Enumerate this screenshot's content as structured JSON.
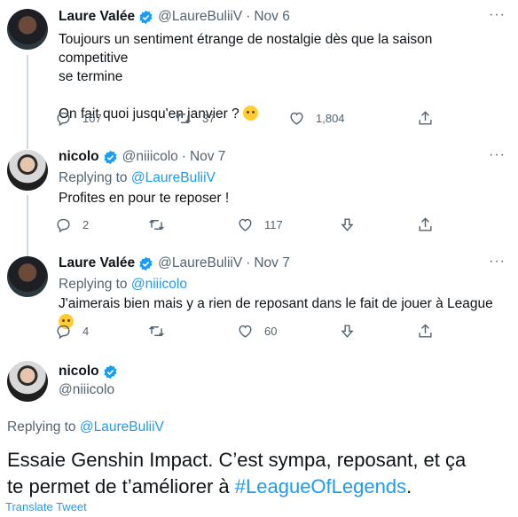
{
  "tweets": [
    {
      "name": "Laure Valée",
      "handle": "@LaureBuliiV",
      "date": "Nov 6",
      "text_line1": "Toujours un sentiment étrange de nostalgie dès que la saison competitive",
      "text_line2": "se termine",
      "text_line3": "On fait quoi jusqu'en janvier ?",
      "replies": "107",
      "retweets": "37",
      "likes": "1,804"
    },
    {
      "name": "nicolo",
      "handle": "@niiicolo",
      "date": "Nov 7",
      "replying_prefix": "Replying to",
      "replying_to": "@LaureBuliiV",
      "text": "Profites en pour te reposer !",
      "replies": "2",
      "retweets": "",
      "likes": "117"
    },
    {
      "name": "Laure Valée",
      "handle": "@LaureBuliiV",
      "date": "Nov 7",
      "replying_prefix": "Replying to",
      "replying_to": "@niiicolo",
      "text": "J'aimerais bien mais y a rien de reposant dans le fait de jouer à League",
      "replies": "4",
      "retweets": "",
      "likes": "60"
    }
  ],
  "main": {
    "name": "nicolo",
    "handle": "@niiicolo",
    "replying_prefix": "Replying to",
    "replying_to": "@LaureBuliiV",
    "text_line1": "Essaie Genshin Impact. C’est sympa, reposant, et ça",
    "text_line2_prefix": "te permet de t’améliorer à ",
    "hashtag": "#LeagueOfLegends",
    "text_line2_suffix": ".",
    "translate": "Translate Tweet"
  },
  "dot": "·",
  "more": "···",
  "colors": {
    "accent": "#1d9bf0",
    "muted": "#536471",
    "text": "#0f1419"
  },
  "icons": [
    "reply-icon",
    "retweet-icon",
    "like-icon",
    "share-icon",
    "downvote-icon",
    "verified-icon",
    "more-icon"
  ]
}
